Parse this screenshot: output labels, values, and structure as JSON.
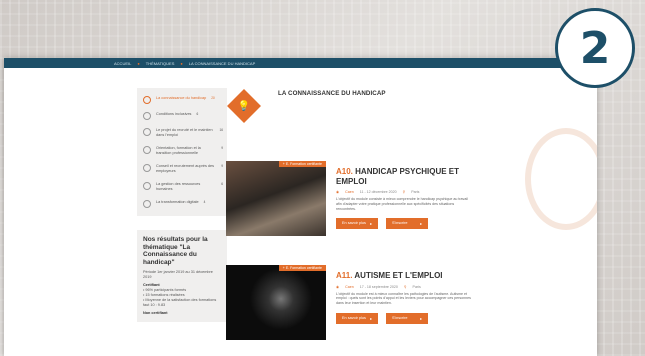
{
  "badge_number": "2",
  "breadcrumb": [
    "ACCUEIL",
    "THÉMATIQUES",
    "LA CONNAISSANCE DU HANDICAP"
  ],
  "sidebar": {
    "items": [
      {
        "label": "La connaissance du handicap",
        "count": "20",
        "icon": "lightbulb-icon",
        "active": true
      },
      {
        "label": "Conditions inclusives",
        "count": "6",
        "icon": "chair-icon",
        "active": false
      },
      {
        "label": "Le projet du recruté et le maintien dans l'emploi",
        "count": "16",
        "icon": "heart-icon",
        "active": false
      },
      {
        "label": "Orientation, formation et la transition professionnelle",
        "count": "9",
        "icon": "compass-icon",
        "active": false
      },
      {
        "label": "Conseil et recrutement auprès des employeurs",
        "count": "9",
        "icon": "handshake-icon",
        "active": false
      },
      {
        "label": "La gestion des ressources humaines",
        "count": "6",
        "icon": "people-icon",
        "active": false
      },
      {
        "label": "La transformation digitale",
        "count": "4",
        "icon": "screen-icon",
        "active": false
      }
    ]
  },
  "results": {
    "title": "Nos résultats pour la thématique \"La Connaissance du handicap\"",
    "period": "Période 1er janvier 2019 au 31 décembre 2019",
    "section1": "Certifiant",
    "bullets": [
      "96% participants formés",
      "15 formations réalisées",
      "Moyenne de la satisfaction des formations faut 10 : 9.83"
    ],
    "section2": "Non certifiant"
  },
  "page_title": "LA CONNAISSANCE DU HANDICAP",
  "theme_icon": "lightbulb-icon",
  "cards": [
    {
      "tag": "+ E. Formation certifiante",
      "code": "A10.",
      "title": "HANDICAP PSYCHIQUE ET EMPLOI",
      "place": "Caen",
      "dates": "11 - 12 décembre 2020",
      "city": "Paris",
      "description": "L'objectif du module consiste à mieux comprendre le handicap psychique au travail afin d'adapter votre pratique professionnelle aux spécificités des situations rencontrées.",
      "btn_more": "En savoir plus",
      "btn_register": "S'inscrire"
    },
    {
      "tag": "+ E. Formation certifiante",
      "code": "A11.",
      "title": "AUTISME ET L'EMPLOI",
      "place": "Caen",
      "dates": "17 - 18 septembre 2020",
      "city": "Paris",
      "description": "L'objectif du module est à mieux connaître les pathologies de l'autisme. Autisme et emploi : quels sont les points d'appui et les leviers pour accompagner ces personnes dans leur insertion et leur maintien.",
      "btn_more": "En savoir plus",
      "btn_register": "S'inscrire"
    }
  ],
  "colors": {
    "accent": "#e26d2a",
    "navy": "#1d4f68"
  }
}
